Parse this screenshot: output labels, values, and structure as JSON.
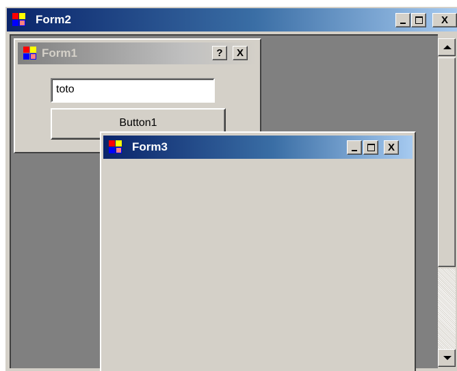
{
  "form2": {
    "title": "Form2",
    "controls": {
      "minimize": "_",
      "maximize": "□",
      "close": "X"
    }
  },
  "form1": {
    "title": "Form1",
    "controls": {
      "help": "?",
      "close": "X"
    },
    "textbox_value": "toto",
    "button_label": "Button1"
  },
  "form3": {
    "title": "Form3",
    "controls": {
      "minimize": "_",
      "maximize": "□",
      "close": "X"
    }
  },
  "icon_colors": {
    "red": "#ff0000",
    "yellow": "#ffff00",
    "blue": "#0000ff",
    "cyan": "#00ffff"
  },
  "accent_colors": {
    "active_title_start": "#0a246a",
    "active_title_end": "#a6caf0",
    "inactive_title": "#808080",
    "face": "#d4d0c8",
    "mdi_background": "#808080"
  }
}
